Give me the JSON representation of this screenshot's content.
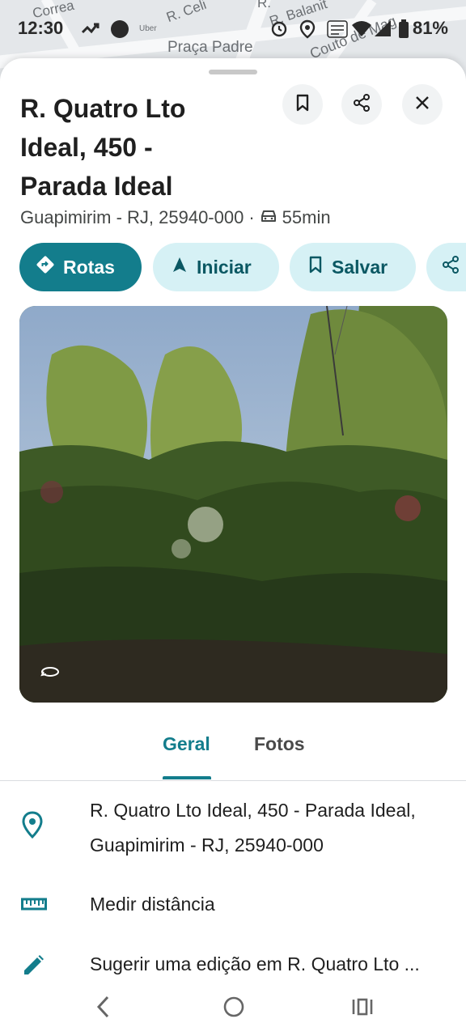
{
  "map": {
    "labels": [
      "Correa",
      "R. Celi",
      "Uber",
      "Praça Padre",
      "R. Balanit",
      "Couto de Mag",
      "R."
    ]
  },
  "status_bar": {
    "time": "12:30",
    "battery": "81%"
  },
  "place": {
    "title_lines": [
      "R. Quatro Lto",
      "Ideal, 450 -",
      "Parada Ideal"
    ],
    "subtitle": "Guapimirim - RJ, 25940-000",
    "separator": "·",
    "drive_time": "55min"
  },
  "actions": {
    "directions": "Rotas",
    "start": "Iniciar",
    "save": "Salvar"
  },
  "tabs": {
    "overview": "Geral",
    "photos": "Fotos"
  },
  "details": {
    "address_line1": "R. Quatro Lto Ideal, 450 - Parada Ideal,",
    "address_line2": "Guapimirim - RJ, 25940-000",
    "measure": "Medir distância",
    "suggest_edit": "Sugerir uma edição em R. Quatro Lto ..."
  },
  "colors": {
    "accent": "#137d8c",
    "chip_secondary": "#d6f1f5",
    "text": "#1f1f1f"
  }
}
